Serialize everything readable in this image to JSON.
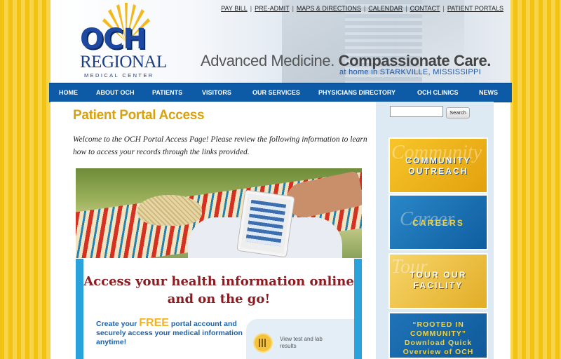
{
  "top_links": [
    "PAY BILL",
    "PRE-ADMIT",
    "MAPS & DIRECTIONS",
    "CALENDAR",
    "CONTACT",
    "PATIENT PORTALS"
  ],
  "logo": {
    "och": "OCH",
    "regional": "REGIONAL",
    "medical_center": "MEDICAL CENTER"
  },
  "tagline": {
    "part1": "Advanced Medicine.",
    "part2": "Compassionate Care.",
    "sub": "at home in STARKVILLE, MISSISSIPPI"
  },
  "nav": [
    "HOME",
    "ABOUT OCH",
    "PATIENTS",
    "VISITORS",
    "OUR SERVICES",
    "PHYSICIANS DIRECTORY",
    "OCH CLINICS",
    "NEWS"
  ],
  "main": {
    "title": "Patient Portal Access",
    "intro": "Welcome to the OCH Portal Access Page!  Please review the following information to learn how to access your records through the links provided.",
    "promo_heading": "Access your health information online and on the go!",
    "promo_pre": "Create your ",
    "promo_free": "FREE",
    "promo_post": " portal account and securely access your medical information anytime!",
    "feature": "View test and lab results"
  },
  "sidebar": {
    "search_button": "Search",
    "boxes": [
      {
        "script": "Community",
        "text": "COMMUNITY OUTREACH",
        "text_color": "#ffffff"
      },
      {
        "script": "Career",
        "text": "CAREERS",
        "text_color": "#f4d23c"
      },
      {
        "script": "Tour",
        "text": "TOUR OUR FACILITY",
        "text_color": "#ffffff"
      },
      {
        "script": "",
        "text": "“ROOTED IN COMMUNITY” Download Quick Overview of OCH",
        "text_color": "#f4d23c"
      }
    ]
  },
  "colors": {
    "nav_bg": "#0d5aa7",
    "title": "#d9a10c",
    "promo_heading": "#8c1c22",
    "background": "#f4c81e"
  }
}
